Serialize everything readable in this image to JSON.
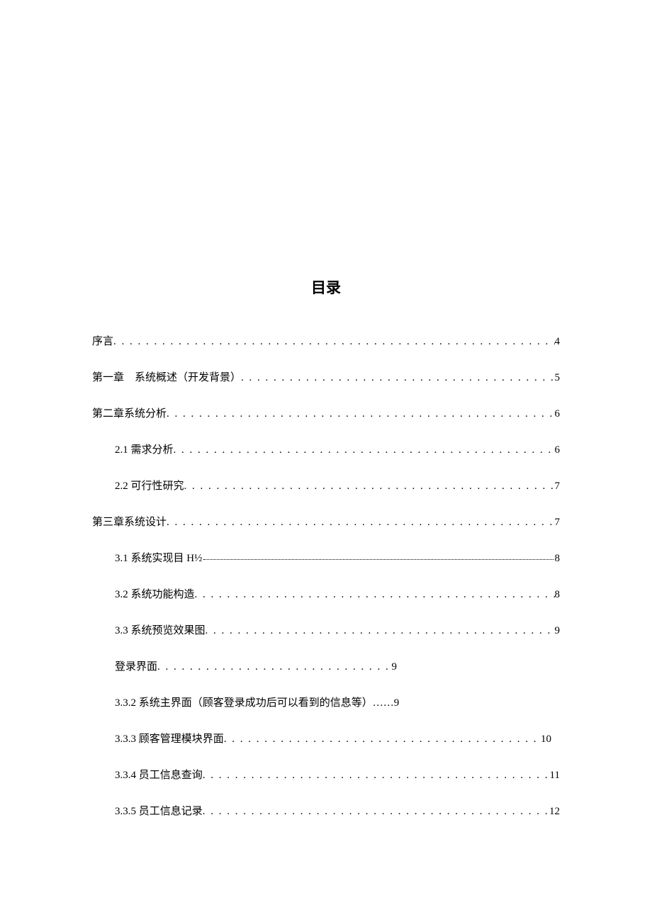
{
  "title": "目录",
  "entries": [
    {
      "label": "序言",
      "page": "4",
      "level": 0,
      "style": "dots"
    },
    {
      "label": "第一章　系统概述（开发背景）",
      "page": "5",
      "level": 0,
      "style": "dots"
    },
    {
      "label": "第二章系统分析",
      "page": "6",
      "level": 0,
      "style": "dots"
    },
    {
      "label": "2.1 需求分析",
      "page": "6",
      "level": 1,
      "style": "dots"
    },
    {
      "label": "2.2 可行性研究",
      "page": "7",
      "level": 1,
      "style": "dots"
    },
    {
      "label": "第三章系统设计",
      "page": "7",
      "level": 0,
      "style": "dots"
    },
    {
      "label": "3.1 系统实现目 H½",
      "page": "8",
      "level": 1,
      "style": "tight"
    },
    {
      "label": "3.2 系统功能构造",
      "page": "8",
      "level": 1,
      "style": "dots"
    },
    {
      "label": "3.3 系统预览效果图",
      "page": "9",
      "level": 1,
      "style": "dots"
    },
    {
      "label": "登录界面",
      "page": "9",
      "level": 1,
      "style": "dots-short"
    },
    {
      "label": "3.3.2 系统主界面（顾客登录成功后可以看到的信息等）……9",
      "page": "",
      "level": 1,
      "style": "none"
    },
    {
      "label": "3.3.3 顾客管理模块界面",
      "page": "10",
      "level": 1,
      "style": "dots-long"
    },
    {
      "label": "3.3.4 员工信息查询",
      "page": "11",
      "level": 1,
      "style": "dots"
    },
    {
      "label": "3.3.5 员工信息记录",
      "page": "12",
      "level": 1,
      "style": "dots"
    }
  ]
}
